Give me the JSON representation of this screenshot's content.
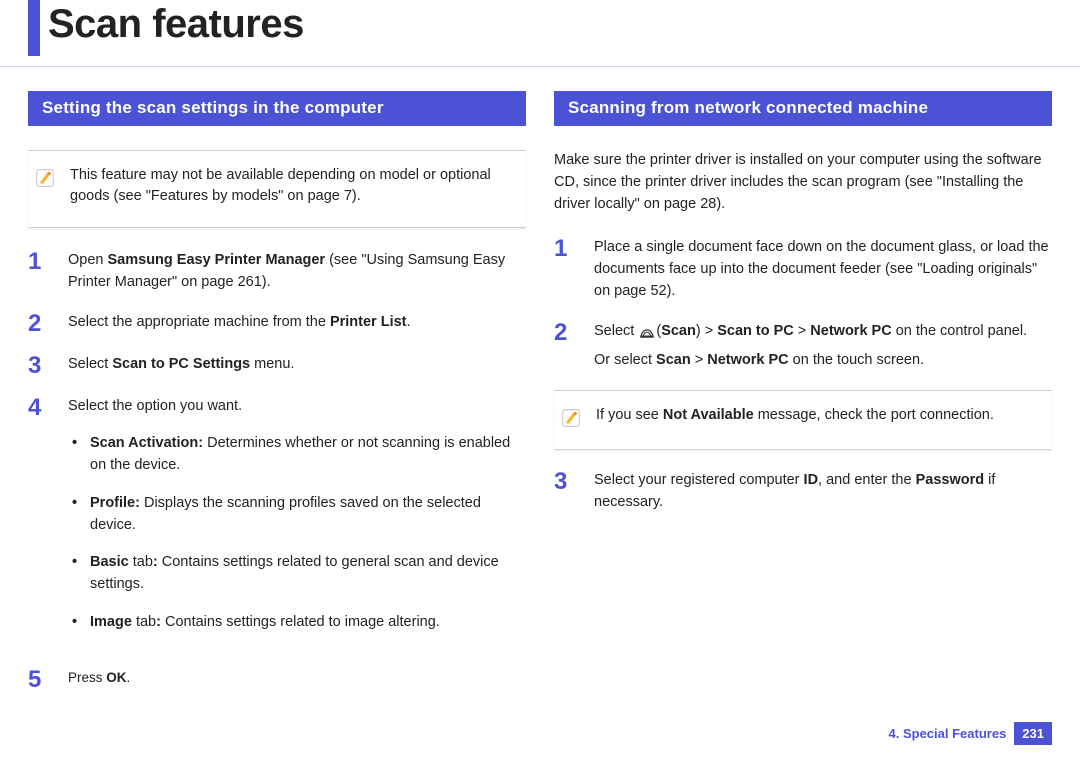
{
  "page_title": "Scan features",
  "left": {
    "header": "Setting the scan settings in the computer",
    "note": "This feature may not be available depending on model or optional goods (see \"Features by models\" on page 7).",
    "steps": {
      "s1_a": "Open ",
      "s1_b": "Samsung Easy Printer Manager",
      "s1_c": " (see \"Using Samsung Easy Printer Manager\" on page 261).",
      "s2_a": "Select the appropriate machine from the ",
      "s2_b": "Printer List",
      "s2_c": ".",
      "s3_a": "Select ",
      "s3_b": "Scan to PC Settings",
      "s3_c": " menu.",
      "s4": "Select the option you want.",
      "s4_b1_a": "Scan Activation:",
      "s4_b1_b": " Determines whether or not scanning is enabled on the device.",
      "s4_b2_a": "Profile:",
      "s4_b2_b": " Displays the scanning profiles saved on the selected device.",
      "s4_b3_a": "Basic",
      "s4_b3_b": " tab",
      "s4_b3_c": ":",
      "s4_b3_d": "  Contains settings related to general scan and device  settings.",
      "s4_b4_a": "Image",
      "s4_b4_b": " tab",
      "s4_b4_c": ":",
      "s4_b4_d": "  Contains settings related to image altering.",
      "s5_a": "Press ",
      "s5_b": "OK",
      "s5_c": "."
    }
  },
  "right": {
    "header": "Scanning from network connected machine",
    "intro": "Make sure the printer driver is installed on your computer using the software CD, since the printer driver includes the scan program (see \"Installing the driver locally\" on page 28).",
    "steps": {
      "s1": "Place a single document face down on the document glass, or load the documents face up into the document feeder (see \"Loading originals\" on page 52).",
      "s2_a": "Select ",
      "s2_b": "(",
      "s2_c": "Scan",
      "s2_d": ") > ",
      "s2_e": "Scan to PC",
      "s2_f": " > ",
      "s2_g": "Network PC",
      "s2_h": " on the control panel.",
      "s2_line2_a": "Or select ",
      "s2_line2_b": "Scan",
      "s2_line2_c": " > ",
      "s2_line2_d": "Network PC",
      "s2_line2_e": " on the touch screen.",
      "note_a": "If you see ",
      "note_b": "Not Available",
      "note_c": " message, check the port connection.",
      "s3_a": "Select your registered computer ",
      "s3_b": "ID",
      "s3_c": ", and enter the ",
      "s3_d": "Password",
      "s3_e": " if necessary."
    }
  },
  "footer": {
    "chapter": "4.  Special Features",
    "page": "231"
  }
}
